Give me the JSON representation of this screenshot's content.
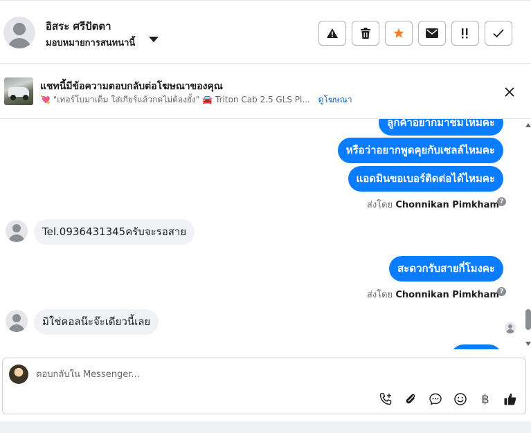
{
  "header": {
    "contact_name": "อิสระ ศรีปัตตา",
    "assign_label": "มอบหมายการสนทนานี้",
    "actions": [
      "report-spam",
      "delete",
      "star",
      "mark-unread",
      "follow-up",
      "mark-done"
    ]
  },
  "ad_banner": {
    "title": "แชทนี้มีข้อความตอบกลับต่อโฆษณาของคุณ",
    "quote": "\"เทอร์โบมาเต็ม ใส่เกียร์แล้วกดไม่ต้องยั้ง\"",
    "vehicle": "Triton Cab 2.5 GLS Pl...",
    "view_ad_link": "ดูโฆษณา"
  },
  "messages": {
    "out_1": "ลูกค้าอยากมาชมไหมคะ",
    "out_2": "หรือว่าอยากพูดคุยกับเซลล์ไหมคะ",
    "out_3": "แอดมินขอเบอร์ติดต่อได้ไหมคะ",
    "sent_by_prefix": "ส่งโดย",
    "sent_by_name": "Chonnikan Pimkham",
    "in_1": "Tel.0936431345ครับจะรอสาย",
    "out_4": "สะดวกรับสายกี่โมงคะ",
    "sent_by_prefix_2": "ส่งโดย",
    "sent_by_name_2": "Chonnikan Pimkham",
    "in_2": "มิใช่คอลน๊ะจ๊ะเดียวนี้เลย"
  },
  "composer": {
    "placeholder": "ตอบกลับใน Messenger...",
    "currency_symbol": "฿"
  },
  "colors": {
    "accent": "#0a7cff",
    "incoming_bubble": "#f0f2f5",
    "star": "#f5802b"
  }
}
